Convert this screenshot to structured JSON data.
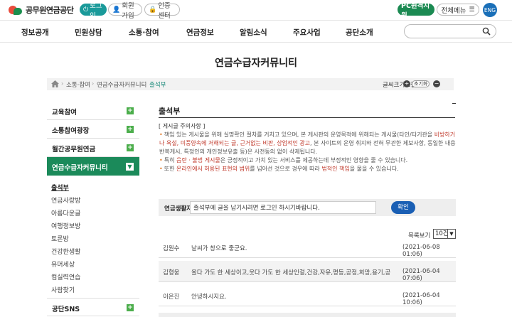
{
  "header": {
    "logo_text": "공무원연금공단",
    "login": "로그인",
    "join": "회원가입",
    "cert": "인증센터",
    "pc_remote": "PC원격지원",
    "all_menu": "전체메뉴",
    "eng": "ENG"
  },
  "gnb": [
    "정보공개",
    "민원상담",
    "소통·참여",
    "연금정보",
    "알림소식",
    "주요사업",
    "공단소개"
  ],
  "search": {
    "placeholder": ""
  },
  "page_title": "연금수급자커뮤니티",
  "breadcrumb": {
    "items": [
      "소통·참여",
      "연금수급자커뮤니티",
      "출석부"
    ],
    "font_size_label": "글씨크기조절",
    "reset": "초기화"
  },
  "lnb": {
    "items": [
      "교육참여",
      "소통참여광장",
      "월간공무원연금",
      "연금수급자커뮤니티",
      "공단SNS"
    ],
    "subitems": [
      "출석부",
      "연금사랑방",
      "아름다운글",
      "여행정보방",
      "토론방",
      "건강한생활",
      "유머세상",
      "컴실력연습",
      "사람찾기"
    ]
  },
  "content": {
    "title": "출석부",
    "notice_head": "[ 게시글 주의사항 ]",
    "notice": {
      "p1_a": "책임 있는 게시물을 위해 실명확인 절차를 거치고 있으며, 본 게시판의 운영목적에 위해되는 게시물(타인/타기관을 ",
      "p1_hl": "비방하거나 욕설, 미풍양속에 저해되는 글, 근거없는 비판, 상업적인 광고",
      "p1_b": ", 본 사이트의 운영 취지와 전혀 무관한 제보사항, 동일한 내용 반복게시, 특정인의 개인정보유출 등)은 사전동의 없이 삭제됩니다.",
      "p2_a": "특히 ",
      "p2_hl": "음란 · 불법 게시물",
      "p2_b": "은 긍정적이고 가치 있는 서비스를 제공하는데 부정적인 영향을 줄 수 있습니다.",
      "p3_a": "또한 ",
      "p3_hl1": "온라인에서 허용된 표현의 범위",
      "p3_b": "를 넘어선 것으로 경우에 따라 ",
      "p3_hl2": "법적인 책임",
      "p3_c": "을 물을 수 있습니다."
    },
    "write": {
      "label": "연금생활자",
      "value": "출석부에 글을 남기시려면 로그인 하시기바랍니다.",
      "ok": "확인"
    },
    "per_page_label": "목록보기 :",
    "per_page_value": "10건",
    "rows": [
      {
        "name": "김원수",
        "message": "날씨가 창으로 좋군요.",
        "date": "(2021-06-08 01:06)"
      },
      {
        "name": "김형웅",
        "message": "올다 가도 한 세상이고,웃다 가도 한 세상인걸,건강,자유,평등,공정,희망,용기,공부하자...",
        "date": "(2021-06-04 07:06)"
      },
      {
        "name": "이은진",
        "message": "안녕하시지요.",
        "date": "(2021-06-04 10:06)"
      }
    ]
  },
  "colors": {
    "teal": "#1a9a9a",
    "green": "#1b8a52",
    "blue": "#1a5fb4",
    "accent_red": "#c0392b"
  }
}
